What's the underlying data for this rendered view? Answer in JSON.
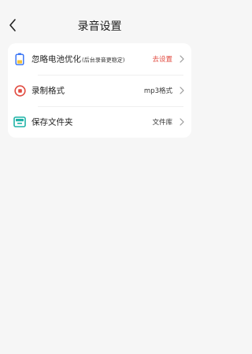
{
  "header": {
    "title": "录音设置",
    "back_icon": "chevron-left-icon"
  },
  "settings": {
    "items": [
      {
        "label": "忽略电池优化",
        "sub_label": "(后台录音更稳定)",
        "value": "去设置",
        "value_color": "#e14a3f",
        "icon": "battery-icon"
      },
      {
        "label": "录制格式",
        "value": "mp3格式",
        "icon": "record-icon"
      },
      {
        "label": "保存文件夹",
        "value": "文件库",
        "icon": "folder-icon"
      }
    ]
  },
  "colors": {
    "background": "#f6f6f6",
    "card": "#ffffff",
    "accent_red": "#e14a3f",
    "icon_blue": "#2f6ef5",
    "icon_teal": "#1fb3a7",
    "icon_yellow": "#f3c33a"
  }
}
